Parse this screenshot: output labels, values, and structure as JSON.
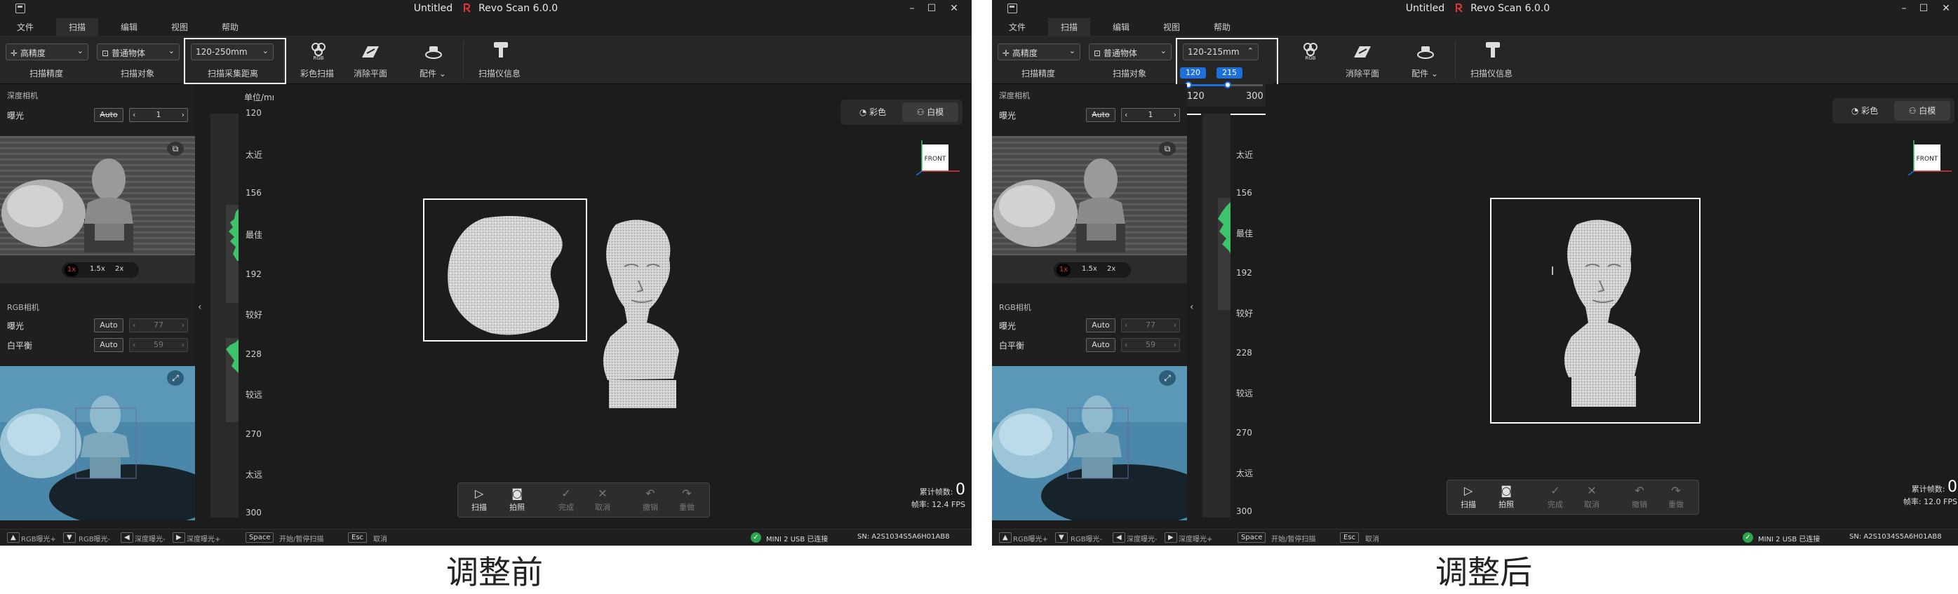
{
  "window_title": "Untitled",
  "product_title": "Revo Scan 6.0.0",
  "menu": [
    "文件",
    "扫描",
    "编辑",
    "视图",
    "帮助"
  ],
  "toolbar": {
    "precision_value": "高精度",
    "precision_label": "扫描精度",
    "object_value": "普通物体",
    "object_label": "扫描对象",
    "distance_label": "扫描采集距离",
    "rgb_label": "彩色扫描",
    "plane_label": "消除平面",
    "accessory_label": "配件",
    "info_label": "扫描仪信息"
  },
  "left_panel": {
    "depth_camera_title": "深度相机",
    "exposure_label": "曝光",
    "auto": "Auto",
    "depth_exposure_value": "1",
    "zoom_options": [
      "1x",
      "1.5x",
      "2x"
    ],
    "rgb_camera_title": "RGB相机",
    "rgb_exposure_value": "77",
    "white_balance_label": "白平衡",
    "white_balance_value": "59"
  },
  "depth_scale": {
    "unit": "单位/mm",
    "labels": [
      "太近",
      "最佳",
      "较好",
      "较远",
      "太远"
    ]
  },
  "view_modes": [
    "彩色",
    "白模"
  ],
  "orientation_label": "FRONT",
  "scan_bar": [
    "扫描",
    "拍照",
    "完成",
    "取消",
    "撤销",
    "重做"
  ],
  "frame_info": {
    "count_label": "累计帧数:",
    "count_value": "0",
    "fps_label": "帧率:"
  },
  "status_bar": {
    "hints": [
      "RGB曝光+",
      "RGB曝光-",
      "深度曝光-",
      "深度曝光+"
    ],
    "space_key": "Space",
    "space_action": "开始/暂停扫描",
    "esc_key": "Esc",
    "esc_action": "取消",
    "connection": "MINI 2 USB 已连接",
    "serial": "SN: A2S1034S5A6H01AB8"
  },
  "before": {
    "distance_value": "120-250mm",
    "depth_ticks": [
      "120",
      "156",
      "192",
      "228",
      "270",
      "300"
    ],
    "fps_value": "12.4 FPS",
    "caption": "调整前"
  },
  "after": {
    "distance_value": "120-215mm",
    "depth_ticks": [
      "156",
      "192",
      "228",
      "270",
      "300"
    ],
    "range_low_badge": "120",
    "range_high_badge": "215",
    "range_min": "120",
    "range_max": "300",
    "range_fraction_low": 0.0,
    "range_fraction_high": 0.53,
    "fps_value": "12.0 FPS",
    "caption": "调整后"
  },
  "colors": {
    "app_bg": "#1c1c1c",
    "toolbar_bg": "#262626",
    "accent_blue": "#1e6fd9",
    "depth_green": "#3cc36b",
    "ok_green": "#2ea44f"
  }
}
